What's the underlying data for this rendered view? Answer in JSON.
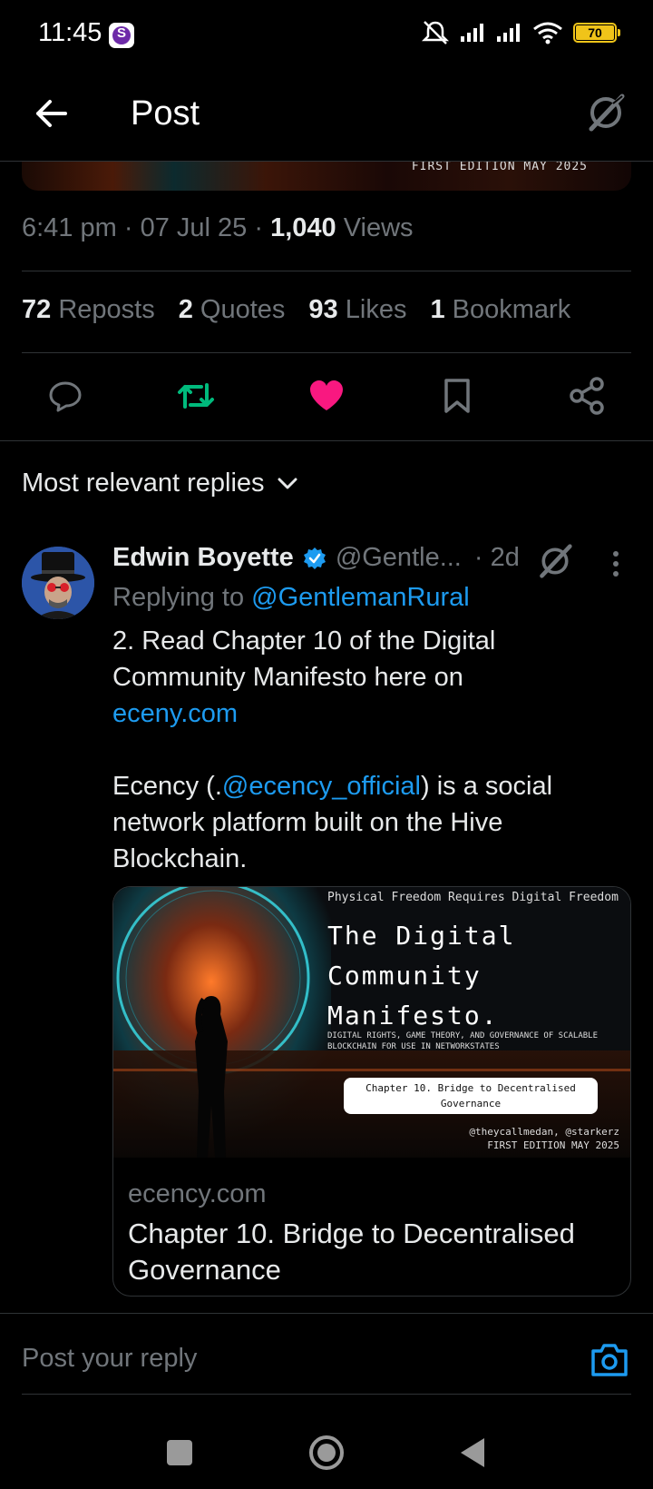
{
  "status_bar": {
    "time": "11:45",
    "app_badge": "S",
    "battery": "70"
  },
  "header": {
    "title": "Post"
  },
  "image_strip": {
    "caption": "FIRST EDITION MAY 2025"
  },
  "post_meta": {
    "time": "6:41 pm",
    "date": "07 Jul 25",
    "views_count": "1,040",
    "views_label": "Views"
  },
  "stats": {
    "reposts_count": "72",
    "reposts_label": "Reposts",
    "quotes_count": "2",
    "quotes_label": "Quotes",
    "likes_count": "93",
    "likes_label": "Likes",
    "bookmarks_count": "1",
    "bookmarks_label": "Bookmark"
  },
  "colors": {
    "accent": "#1d9bf0",
    "repost_active": "#00ba7c",
    "like_active": "#f91880"
  },
  "sort": {
    "label": "Most relevant replies"
  },
  "reply": {
    "name": "Edwin Boyette",
    "handle": "@Gentle...",
    "age": "· 2d",
    "replying_prefix": "Replying to",
    "replying_handle": "@GentlemanRural",
    "line1": "2.  Read Chapter 10 of the Digital Community Manifesto here on",
    "link1": "eceny.com",
    "line2_pre": "Ecency (.",
    "line2_mention": "@ecency_official",
    "line2_post": ")  is a social network platform built on the Hive Blockchain."
  },
  "card": {
    "image_top": "Physical Freedom Requires Digital Freedom",
    "image_title": "The Digital\nCommunity\nManifesto.",
    "image_subtitle": "DIGITAL RIGHTS, GAME THEORY, AND GOVERNANCE OF SCALABLE BLOCKCHAIN FOR USE IN NETWORKSTATES",
    "image_pill": "Chapter 10. Bridge to Decentralised Governance",
    "image_credit": "@theycallmedan, @starkerz",
    "image_edition": "FIRST EDITION MAY 2025",
    "domain": "ecency.com",
    "title": "Chapter 10. Bridge to Decentralised Governance"
  },
  "compose": {
    "placeholder": "Post your reply"
  }
}
